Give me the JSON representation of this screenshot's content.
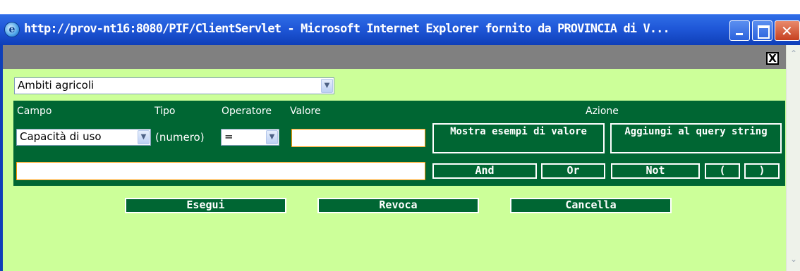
{
  "window": {
    "title": "http://prov-nt16:8080/PIF/ClientServlet - Microsoft Internet Explorer fornito da PROVINCIA di V...",
    "close_box": "X"
  },
  "layer_select": {
    "value": "Ambiti agricoli"
  },
  "headers": {
    "campo": "Campo",
    "tipo": "Tipo",
    "operatore": "Operatore",
    "valore": "Valore",
    "azione": "Azione"
  },
  "field_select": {
    "value": "Capacità di uso"
  },
  "type_label": "(numero)",
  "operator_select": {
    "value": "="
  },
  "value_input": {
    "value": ""
  },
  "query_input": {
    "value": ""
  },
  "buttons": {
    "show_examples": "Mostra esempi di valore",
    "add_query": "Aggiungi al query string",
    "and": "And",
    "or": "Or",
    "not": "Not",
    "open_paren": "(",
    "close_paren": ")",
    "execute": "Esegui",
    "revoke": "Revoca",
    "clear": "Cancella"
  },
  "colors": {
    "background": "#ccff99",
    "panel": "#006633",
    "input_border": "#ff9900",
    "title_bar": "#1f57d8"
  }
}
